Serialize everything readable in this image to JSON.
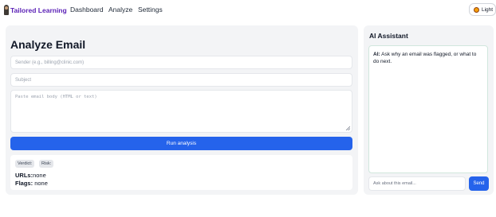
{
  "app": {
    "brand": "Tailored Learning"
  },
  "nav": {
    "items": [
      "Dashboard",
      "Analyze",
      "Settings"
    ]
  },
  "theme": {
    "label": "Light",
    "icon": "sun-icon"
  },
  "analyze": {
    "title": "Analyze Email",
    "sender_placeholder": "Sender (e.g., billing@clinic.com)",
    "subject_placeholder": "Subject",
    "body_placeholder": "Paste email body (HTML or text)",
    "run_label": "Run analysis",
    "results": {
      "verdict_label": "Verdict:",
      "risk_label": "Risk:",
      "urls_label": "URLs:",
      "urls_value": "none",
      "flags_label": "Flags:",
      "flags_value": "none"
    }
  },
  "assistant": {
    "title": "AI Assistant",
    "message_prefix": "AI:",
    "message": "Ask why an email was flagged, or what to do next.",
    "input_placeholder": "Ask about this email...",
    "send_label": "Send"
  },
  "colors": {
    "accent": "#2563eb",
    "brand": "#5b21b6",
    "panel": "#f3f4f6"
  }
}
